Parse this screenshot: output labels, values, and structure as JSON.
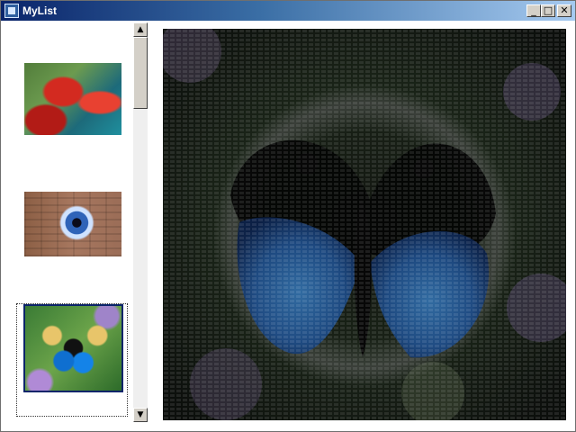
{
  "window": {
    "title": "MyList"
  },
  "titlebar_buttons": [
    {
      "name": "minimize",
      "glyph": "_"
    },
    {
      "name": "maximize",
      "glyph": "□"
    },
    {
      "name": "close",
      "glyph": "✕"
    }
  ],
  "list": {
    "items": [
      {
        "subject": "parrots"
      },
      {
        "subject": "eye"
      },
      {
        "subject": "butterfly",
        "selected": true
      }
    ]
  },
  "scrollbar": {
    "up_glyph": "▲",
    "down_glyph": "▼"
  },
  "preview": {
    "subject": "butterfly"
  },
  "colors": {
    "titlebar_start": "#0a246a",
    "titlebar_end": "#a6caf0",
    "selection": "#0a246a"
  }
}
